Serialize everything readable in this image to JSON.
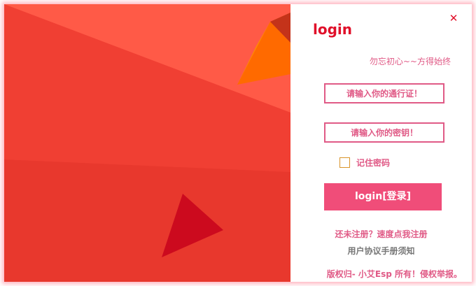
{
  "window": {
    "title": "login",
    "close_glyph": "✕",
    "close_icon": "close-icon"
  },
  "login": {
    "slogan": "勿忘初心~~方得始终",
    "username_placeholder": "请输入你的通行证！",
    "password_placeholder": "请输入你的密钥！",
    "remember_label": "记住密码",
    "remember_checked": false,
    "submit_label": "login[登录]",
    "register_link": "还未注册？速度点我注册",
    "terms_link": "用户协议手册须知",
    "copyright": "版权归- 小艾Esp 所有！侵权举报。"
  },
  "colors": {
    "accent": "#e0102a",
    "pink": "#e05a86",
    "button": "#f04d79",
    "background_red": "#f2453a"
  }
}
